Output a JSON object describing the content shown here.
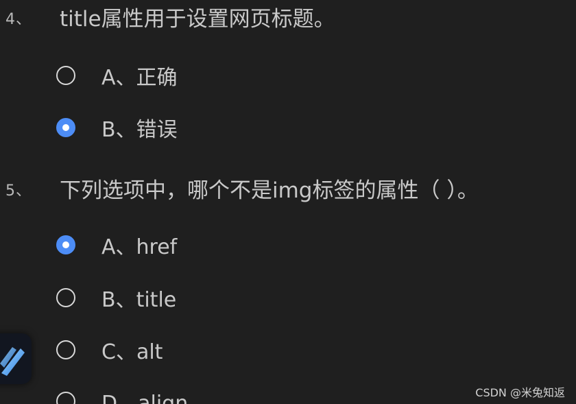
{
  "questions": [
    {
      "number": "4、",
      "text": "title属性用于设置网页标题。",
      "options": [
        {
          "label": "A、正确",
          "checked": false
        },
        {
          "label": "B、错误",
          "checked": true
        }
      ]
    },
    {
      "number": "5、",
      "text": "下列选项中，哪个不是img标签的属性（   ）。",
      "options": [
        {
          "label": "A、href",
          "checked": true
        },
        {
          "label": "B、title",
          "checked": false
        },
        {
          "label": "C、alt",
          "checked": false
        },
        {
          "label": "D、align",
          "checked": false
        }
      ]
    }
  ],
  "watermark": "CSDN @米兔知返",
  "colors": {
    "background": "#1f1f1f",
    "radio_selected": "#4d8df6",
    "text": "#c9c9c9"
  },
  "icons": {
    "floating_app": "feather-app-icon"
  }
}
